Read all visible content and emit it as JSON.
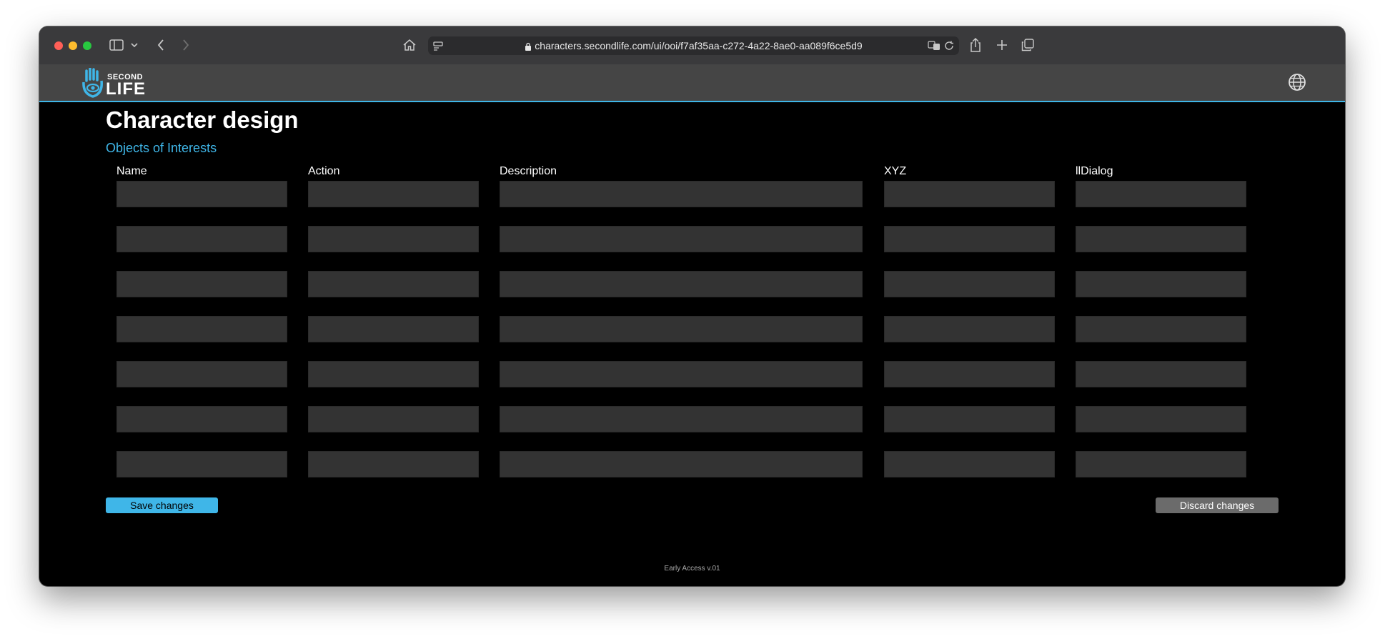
{
  "browser": {
    "url": "characters.secondlife.com/ui/ooi/f7af35aa-c272-4a22-8ae0-aa089f6ce5d9"
  },
  "header": {
    "logo_top": "SECOND",
    "logo_bottom": "LIFE"
  },
  "page": {
    "title": "Character design",
    "section": "Objects of Interests"
  },
  "table": {
    "columns": [
      "Name",
      "Action",
      "Description",
      "XYZ",
      "llDialog"
    ],
    "rows": [
      [
        "",
        "",
        "",
        "",
        ""
      ],
      [
        "",
        "",
        "",
        "",
        ""
      ],
      [
        "",
        "",
        "",
        "",
        ""
      ],
      [
        "",
        "",
        "",
        "",
        ""
      ],
      [
        "",
        "",
        "",
        "",
        ""
      ],
      [
        "",
        "",
        "",
        "",
        ""
      ],
      [
        "",
        "",
        "",
        "",
        ""
      ]
    ]
  },
  "actions": {
    "save_label": "Save changes",
    "discard_label": "Discard changes"
  },
  "footer": {
    "text": "Early Access v.01"
  },
  "colors": {
    "accent": "#3fb6e8",
    "background": "#000000",
    "header": "#454545",
    "field": "#333333"
  }
}
